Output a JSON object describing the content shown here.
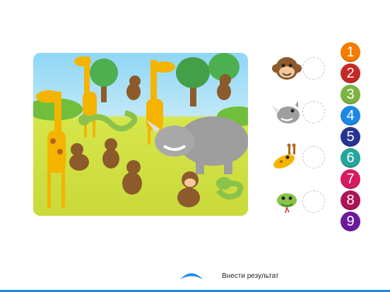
{
  "submit": {
    "label": "Внести результат"
  },
  "numbers": [
    {
      "label": "1",
      "color": "#f57c00"
    },
    {
      "label": "2",
      "color": "#c62828"
    },
    {
      "label": "3",
      "color": "#7cb342"
    },
    {
      "label": "4",
      "color": "#1e88e5"
    },
    {
      "label": "5",
      "color": "#283593"
    },
    {
      "label": "6",
      "color": "#26a69a"
    },
    {
      "label": "7",
      "color": "#d81b60"
    },
    {
      "label": "8",
      "color": "#ad1457"
    },
    {
      "label": "9",
      "color": "#6a1b9a"
    }
  ],
  "animals": [
    {
      "name": "monkey-face-icon"
    },
    {
      "name": "rhino-face-icon"
    },
    {
      "name": "giraffe-face-icon"
    },
    {
      "name": "snake-face-icon"
    }
  ],
  "colors": {
    "accent": "#1e88e5"
  }
}
